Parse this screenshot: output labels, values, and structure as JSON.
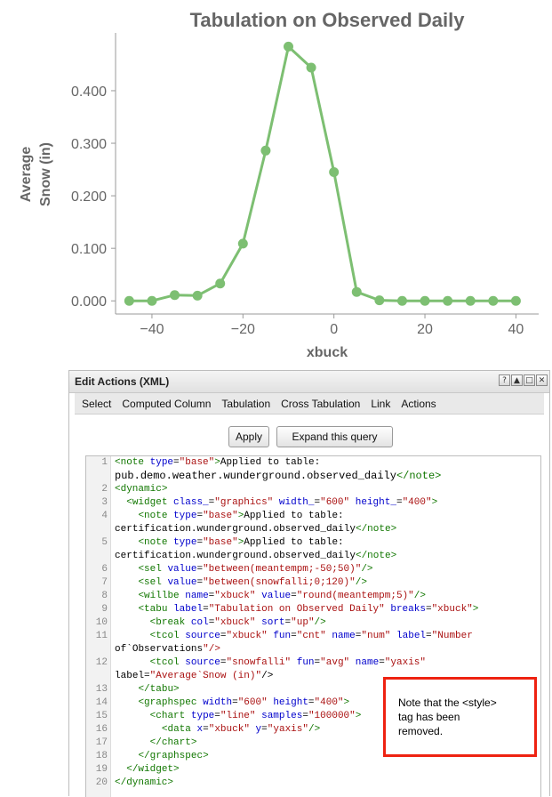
{
  "chart_data": {
    "type": "line",
    "title": "Tabulation on Observed Daily",
    "xlabel": "xbuck",
    "ylabel_lines": [
      "Average",
      "Snow (in)"
    ],
    "x": [
      -45,
      -40,
      -35,
      -30,
      -25,
      -20,
      -15,
      -10,
      -5,
      0,
      5,
      10,
      15,
      20,
      25,
      30,
      35,
      40
    ],
    "series": [
      {
        "values": [
          0.0,
          0.0,
          0.011,
          0.01,
          0.033,
          0.109,
          0.286,
          0.484,
          0.444,
          0.245,
          0.017,
          0.001,
          0.0,
          0.0,
          0.0,
          0.0,
          0.0,
          0.0
        ]
      }
    ],
    "xlim": [
      -48,
      45
    ],
    "ylim": [
      -0.025,
      0.51
    ],
    "xticks": [
      -40,
      -20,
      0,
      20,
      40
    ],
    "xtick_labels": [
      "−40",
      "−20",
      "0",
      "20",
      "40"
    ],
    "yticks": [
      0,
      0.1,
      0.2,
      0.3,
      0.4
    ],
    "ytick_labels": [
      "0.000",
      "0.100",
      "0.200",
      "0.300",
      "0.400"
    ],
    "color": "#7dbf72",
    "grid": false
  },
  "panel": {
    "title": "Edit Actions (XML)",
    "window_buttons": [
      {
        "name": "help-icon",
        "glyph": "?"
      },
      {
        "name": "collapse-icon",
        "glyph": "▲"
      },
      {
        "name": "maximize-icon",
        "glyph": "□"
      },
      {
        "name": "close-icon",
        "glyph": "✕"
      }
    ],
    "menu": [
      "Select",
      "Computed Column",
      "Tabulation",
      "Cross Tabulation",
      "Link",
      "Actions"
    ],
    "apply_label": "Apply",
    "expand_label": "Expand this query"
  },
  "code_lines": [
    {
      "n": "1",
      "text": "<note type=\"base\">Applied to table:"
    },
    {
      "n": "",
      "text": "pub.demo.weather.wunderground.observed_daily</note>",
      "big": true
    },
    {
      "n": "2",
      "text": "<dynamic>"
    },
    {
      "n": "3",
      "text": "  <widget class_=\"graphics\" width_=\"600\" height_=\"400\">"
    },
    {
      "n": "4",
      "text": "    <note type=\"base\">Applied to table:"
    },
    {
      "n": "",
      "text": "certification.wunderground.observed_daily</note>"
    },
    {
      "n": "5",
      "text": "    <note type=\"base\">Applied to table:"
    },
    {
      "n": "",
      "text": "certification.wunderground.observed_daily</note>"
    },
    {
      "n": "6",
      "text": "    <sel value=\"between(meantempm;-50;50)\"/>"
    },
    {
      "n": "7",
      "text": "    <sel value=\"between(snowfalli;0;120)\"/>"
    },
    {
      "n": "8",
      "text": "    <willbe name=\"xbuck\" value=\"round(meantempm;5)\"/>"
    },
    {
      "n": "9",
      "text": "    <tabu label=\"Tabulation on Observed Daily\" breaks=\"xbuck\">"
    },
    {
      "n": "10",
      "text": "      <break col=\"xbuck\" sort=\"up\"/>"
    },
    {
      "n": "11",
      "text": "      <tcol source=\"xbuck\" fun=\"cnt\" name=\"num\" label=\"Number"
    },
    {
      "n": "",
      "text": "of`Observations\"/>"
    },
    {
      "n": "12",
      "text": "      <tcol source=\"snowfalli\" fun=\"avg\" name=\"yaxis\""
    },
    {
      "n": "",
      "text": "label=\"Average`Snow (in)\"/>"
    },
    {
      "n": "13",
      "text": "    </tabu>"
    },
    {
      "n": "14",
      "text": "    <graphspec width=\"600\" height=\"400\">"
    },
    {
      "n": "15",
      "text": "      <chart type=\"line\" samples=\"100000\">"
    },
    {
      "n": "16",
      "text": "        <data x=\"xbuck\" y=\"yaxis\"/>"
    },
    {
      "n": "17",
      "text": "      </chart>"
    },
    {
      "n": "18",
      "text": "    </graphspec>"
    },
    {
      "n": "19",
      "text": "  </widget>"
    },
    {
      "n": "20",
      "text": "</dynamic>"
    }
  ],
  "note_callout": "Note that the <style>\ntag has been\nremoved."
}
